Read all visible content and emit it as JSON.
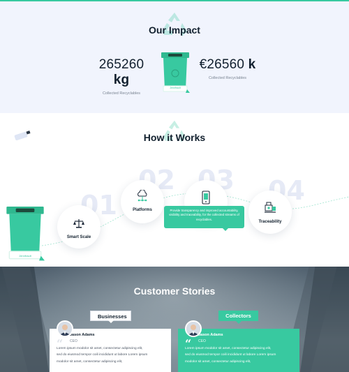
{
  "colors": {
    "accent": "#38c9a0",
    "impact_bg": "#f1f4fd",
    "heading": "#12202e"
  },
  "impact": {
    "title": "Our Impact",
    "stats": [
      {
        "number": "265260",
        "unit": "kg",
        "label": "Collected Recyclables"
      },
      {
        "number": "€26560",
        "unit": "k",
        "label": "Collected Recyclables"
      }
    ],
    "bin_label": "Jennfrault"
  },
  "how_it_works": {
    "title": "How it Works",
    "bg_numbers": [
      "01",
      "02",
      "03",
      "04"
    ],
    "bin_label": "Jennfrault",
    "steps": [
      {
        "label": "Smart Scale",
        "icon": "scale-icon"
      },
      {
        "label": "Platforms",
        "icon": "cloud-network-icon"
      },
      {
        "label": "",
        "icon": "smartphone-icon"
      },
      {
        "label": "Traceability",
        "icon": "machine-icon"
      }
    ],
    "tooltip": "Provide transparency and improved accountability, visibility and traceability, for the collected streams of recyclables."
  },
  "stories": {
    "title": "Customer Stories",
    "tabs": [
      {
        "label": "Businesses"
      },
      {
        "label": "Collectors"
      }
    ],
    "cards": [
      {
        "name": "Jason Adams",
        "role": "CEO",
        "lines": [
          "Lorem ipsum modolor sit amet, consectetur adipiscing elit,",
          "sed do eiusmod tempor coili incididunt ut labore Lorem ipsum",
          "modolor sit amet, consectetur adipiscing elit,"
        ]
      },
      {
        "name": "Jason Adams",
        "role": "CEO",
        "lines": [
          "Lorem ipsum modolor sit amet, consectetur adipiscing elit,",
          "sed do eiusmod tempor coili incididunt ut labore Lorem ipsum",
          "modolor sit amet, consectetur adipiscing elit,"
        ]
      }
    ]
  }
}
